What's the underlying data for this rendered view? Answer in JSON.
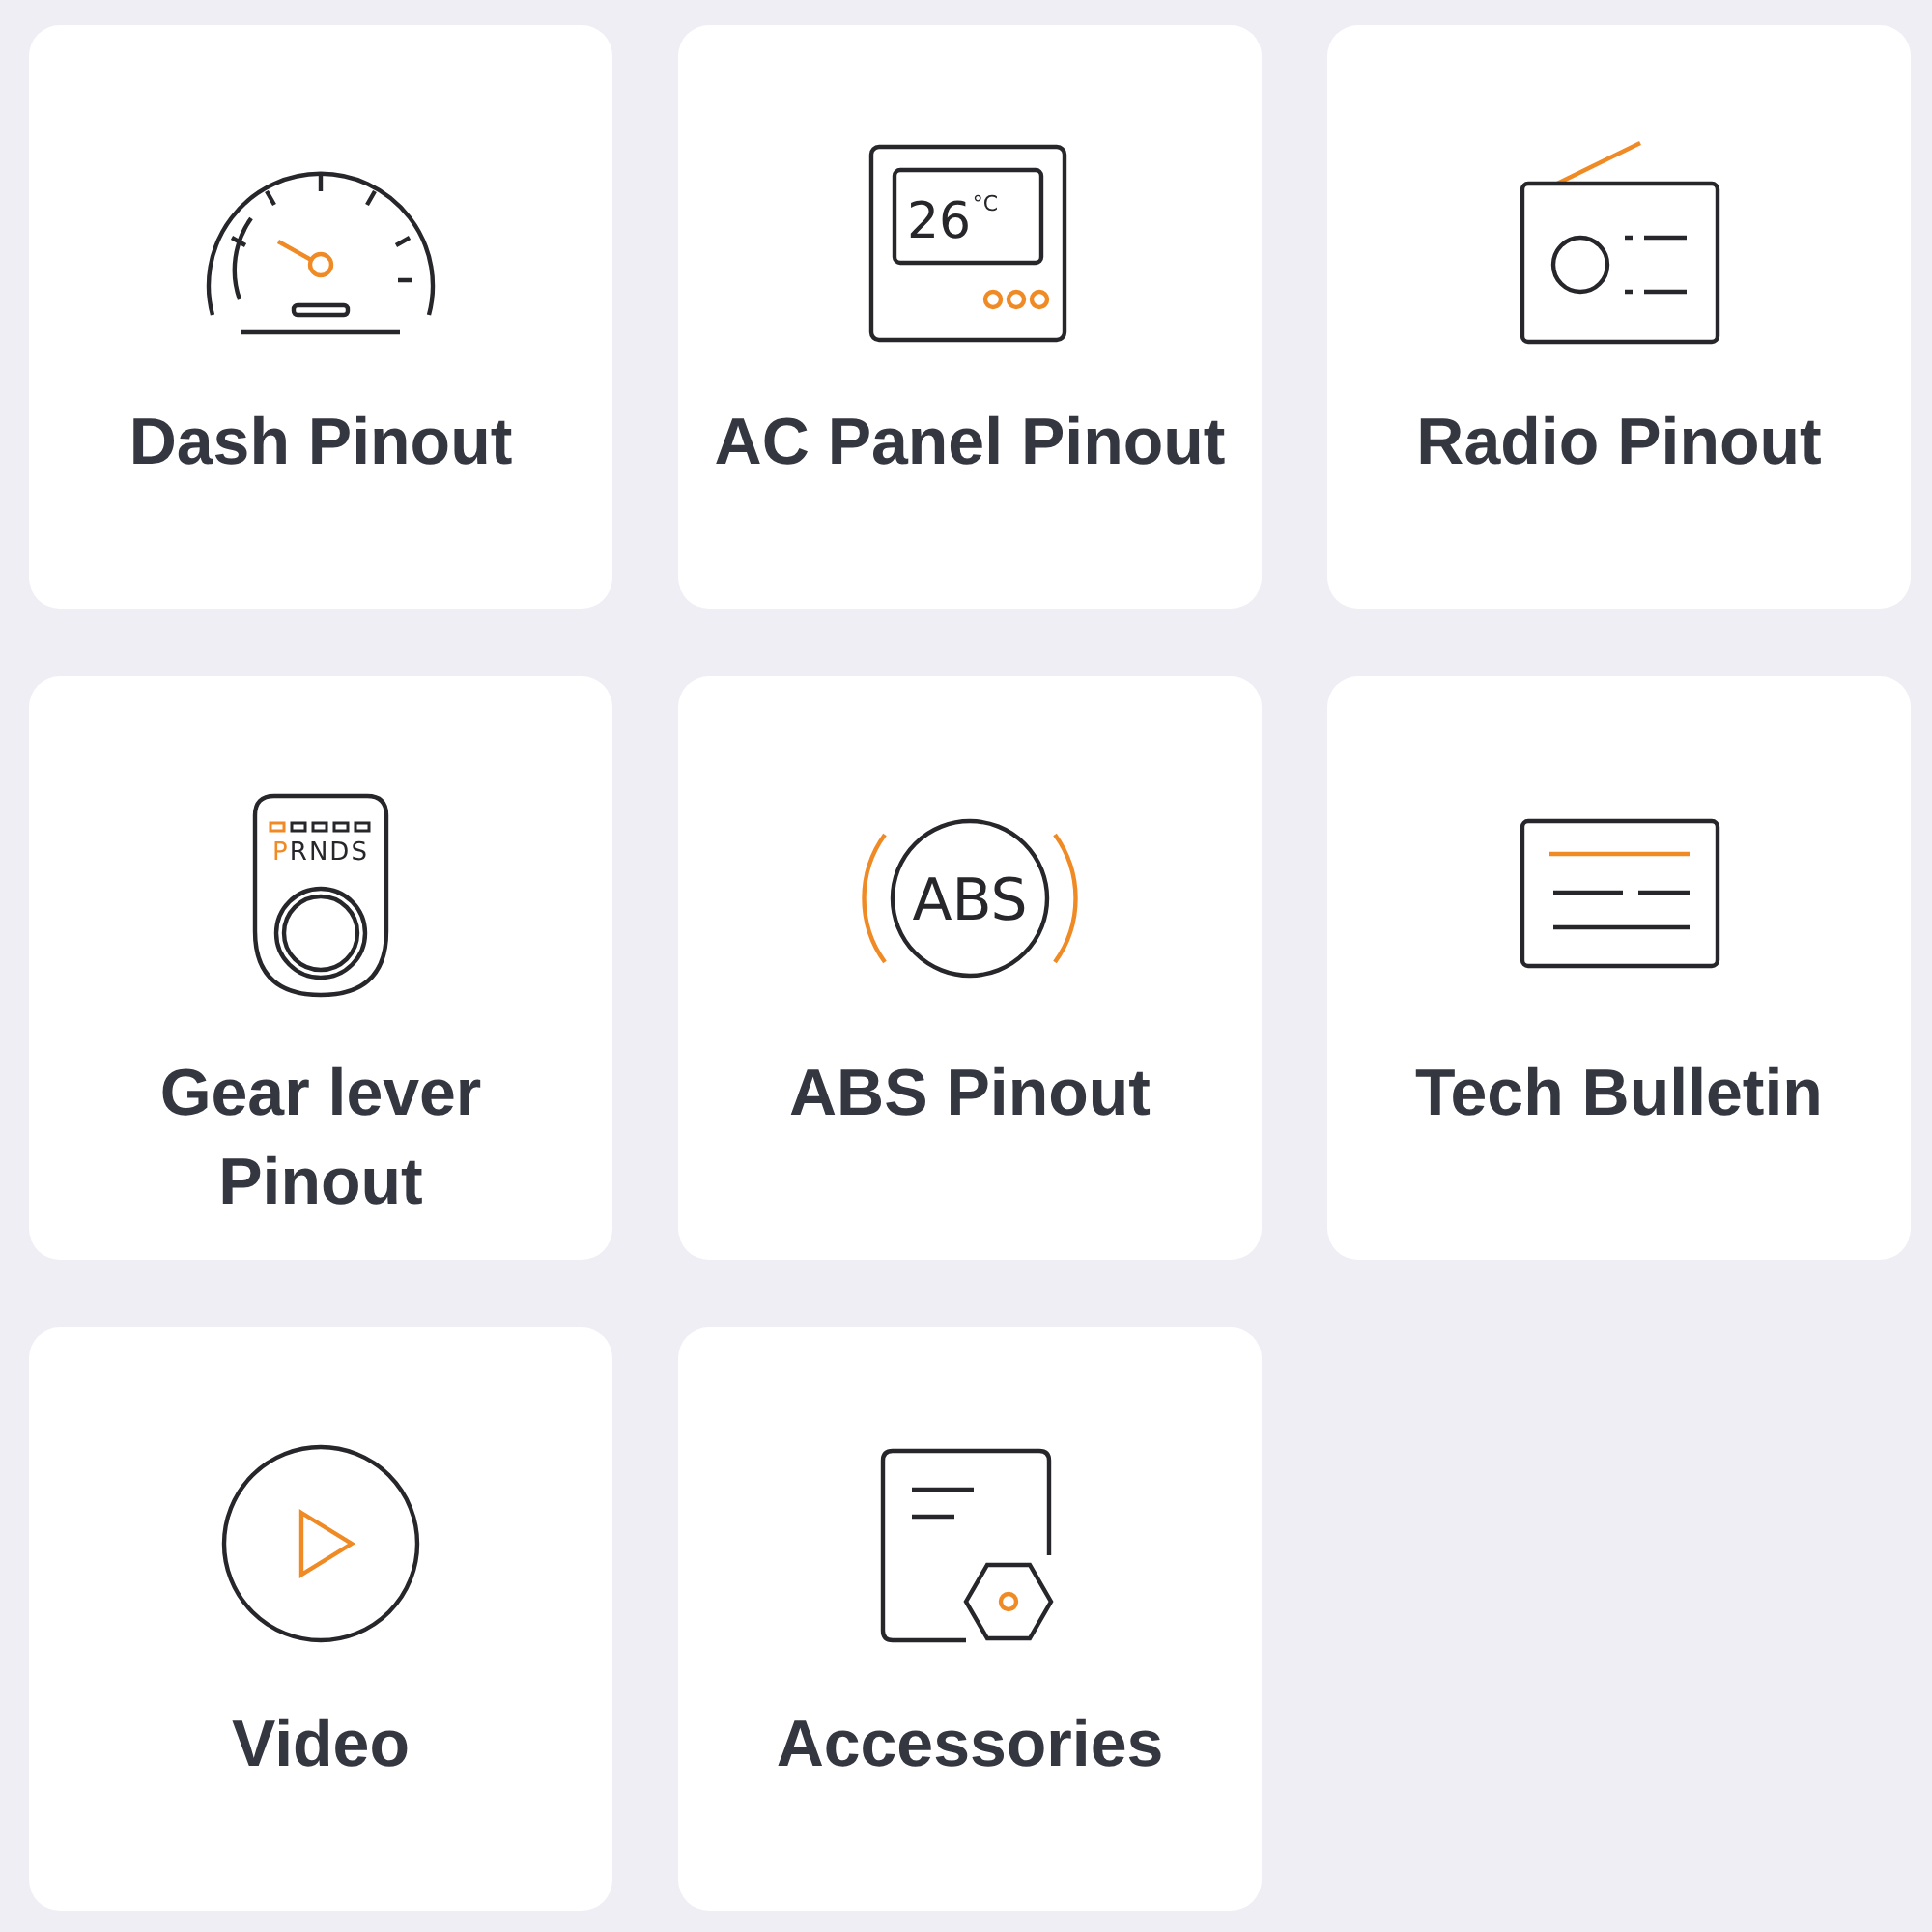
{
  "tiles": [
    {
      "kind": "gauge",
      "title": "Dash Pinout"
    },
    {
      "kind": "thermostat",
      "title": "AC Panel Pinout",
      "reading": "26",
      "unit": "°C"
    },
    {
      "kind": "radio",
      "title": "Radio Pinout"
    },
    {
      "kind": "gear",
      "title": "Gear lever Pinout",
      "gears": [
        {
          "label": "P",
          "selected": true
        },
        {
          "label": "R",
          "selected": false
        },
        {
          "label": "N",
          "selected": false
        },
        {
          "label": "D",
          "selected": false
        },
        {
          "label": "S",
          "selected": false
        }
      ]
    },
    {
      "kind": "abs",
      "title": "ABS Pinout",
      "badge": "ABS"
    },
    {
      "kind": "bulletin",
      "title": "Tech Bulletin"
    },
    {
      "kind": "video",
      "title": "Video"
    },
    {
      "kind": "accessories",
      "title": "Accessories"
    }
  ]
}
